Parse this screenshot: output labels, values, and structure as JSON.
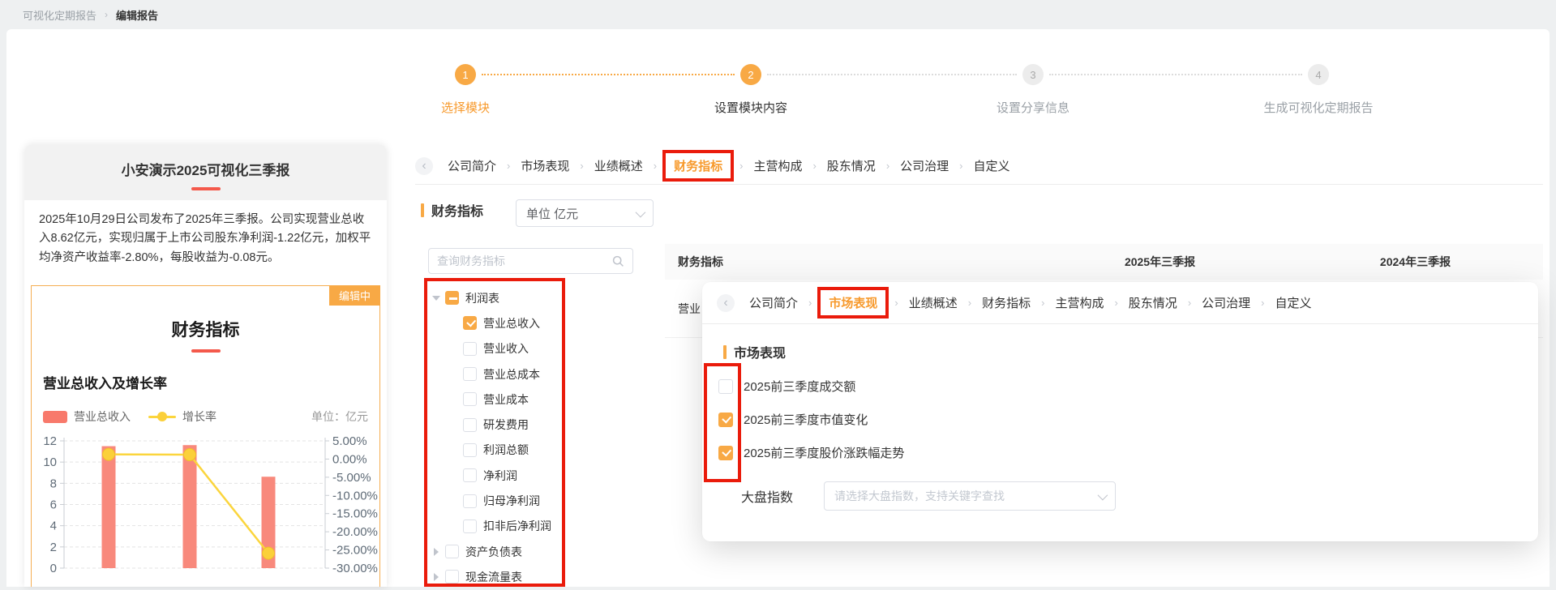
{
  "breadcrumb": {
    "parent": "可视化定期报告",
    "separator": "›",
    "current": "编辑报告"
  },
  "stepper": {
    "steps": [
      {
        "num": "1",
        "label": "选择模块",
        "state": "active"
      },
      {
        "num": "2",
        "label": "设置模块内容",
        "state": "current"
      },
      {
        "num": "3",
        "label": "设置分享信息",
        "state": "pending"
      },
      {
        "num": "4",
        "label": "生成可视化定期报告",
        "state": "pending"
      }
    ]
  },
  "preview_card": {
    "title": "小安演示2025可视化三季报",
    "summary": "2025年10月29日公司发布了2025年三季报。公司实现营业总收入8.62亿元，实现归属于上市公司股东净利润-1.22亿元，加权平均净资产收益率-2.80%，每股收益为-0.08元。",
    "editing_badge": "编辑中",
    "section_title": "财务指标",
    "chart_heading": "营业总收入及增长率",
    "legend": {
      "bar": "营业总收入",
      "line": "增长率",
      "unit": "单位：亿元"
    }
  },
  "chart_data": {
    "type": "bar",
    "title": "营业总收入及增长率",
    "unit_label": "单位：亿元",
    "categories": [
      "",
      "",
      ""
    ],
    "series": [
      {
        "name": "营业总收入",
        "type": "bar",
        "axis": "left",
        "values": [
          11.5,
          11.6,
          8.62
        ]
      },
      {
        "name": "增长率",
        "type": "line",
        "axis": "right",
        "values": [
          1.3,
          1.2,
          -25.9
        ]
      }
    ],
    "left_axis": {
      "ticks": [
        12,
        10,
        8,
        6,
        4,
        2,
        0
      ],
      "range": [
        0,
        12
      ]
    },
    "right_axis": {
      "ticks": [
        "5.00%",
        "0.00%",
        "-5.00%",
        "-10.00%",
        "-15.00%",
        "-20.00%",
        "-25.00%",
        "-30.00%"
      ],
      "range": [
        -30,
        5
      ]
    },
    "grid": "dashed-horizontal",
    "legend_position": "top",
    "note": "x-axis category labels cut off at bottom of screenshot"
  },
  "tabs": {
    "back_icon": "‹",
    "separator": "›",
    "items": [
      "公司简介",
      "市场表现",
      "业绩概述",
      "财务指标",
      "主营构成",
      "股东情况",
      "公司治理",
      "自定义"
    ],
    "main_active": "财务指标",
    "modal_active": "市场表现"
  },
  "section": {
    "title": "财务指标",
    "unit_select_value": "单位 亿元"
  },
  "tree": {
    "search_placeholder": "查询财务指标",
    "items": [
      {
        "label": "利润表",
        "level": 0,
        "state": "indeterminate",
        "caret": "down"
      },
      {
        "label": "营业总收入",
        "level": 1,
        "state": "checked"
      },
      {
        "label": "营业收入",
        "level": 1,
        "state": "unchecked"
      },
      {
        "label": "营业总成本",
        "level": 1,
        "state": "unchecked"
      },
      {
        "label": "营业成本",
        "level": 1,
        "state": "unchecked"
      },
      {
        "label": "研发费用",
        "level": 1,
        "state": "unchecked"
      },
      {
        "label": "利润总额",
        "level": 1,
        "state": "unchecked"
      },
      {
        "label": "净利润",
        "level": 1,
        "state": "unchecked"
      },
      {
        "label": "归母净利润",
        "level": 1,
        "state": "unchecked"
      },
      {
        "label": "扣非后净利润",
        "level": 1,
        "state": "unchecked"
      },
      {
        "label": "资产负债表",
        "level": 0,
        "state": "unchecked",
        "caret": "right"
      },
      {
        "label": "现金流量表",
        "level": 0,
        "state": "unchecked",
        "caret": "right"
      }
    ]
  },
  "table": {
    "columns": [
      "财务指标",
      "2025年三季报",
      "2024年三季报"
    ],
    "row_label_visible": "营业"
  },
  "modal": {
    "section_title": "市场表现",
    "checkboxes": [
      {
        "label": "2025前三季度成交额",
        "checked": false
      },
      {
        "label": "2025前三季度市值变化",
        "checked": true
      },
      {
        "label": "2025前三季度股价涨跌幅走势",
        "checked": true
      }
    ],
    "index_label": "大盘指数",
    "index_placeholder": "请选择大盘指数，支持关键字查找"
  },
  "colors": {
    "accent_orange": "#F8A945",
    "active_text_orange": "#F79A2D",
    "highlight_red": "#EA1B0B",
    "title_underline_red": "#F4594B",
    "bar_fill": "#F8897C",
    "line_yellow": "#FBD53D"
  }
}
